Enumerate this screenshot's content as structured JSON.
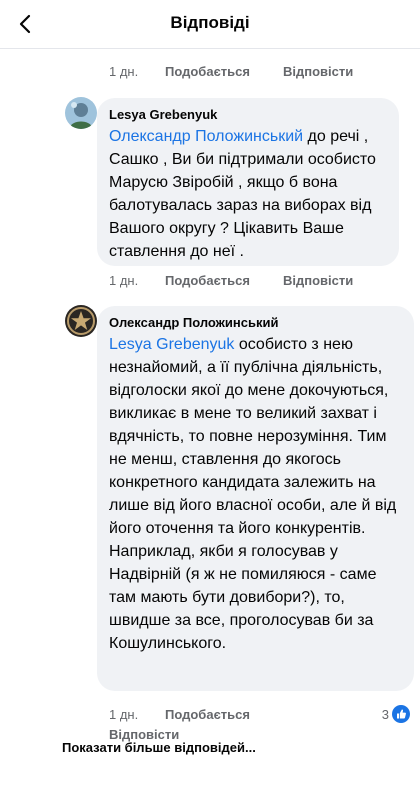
{
  "header": {
    "title": "Відповіді"
  },
  "top_actions": {
    "time": "1 дн.",
    "like": "Подобається",
    "reply": "Відповісти"
  },
  "comments": [
    {
      "author": "Lesya Grebenyuk",
      "mention": "Олександр Положинський",
      "text": " до речі , Сашко , Ви би підтримали особисто Марусю Звіробій , якщо б вона балотувалась зараз на виборах від Вашого округу ? Цікавить Ваше ставлення до неї .",
      "time": "1 дн.",
      "like": "Подобається",
      "reply": "Відповісти"
    },
    {
      "author": "Олександр Положинський",
      "mention": "Lesya Grebenyuk",
      "text": " особисто з нею незнайомий, а її публічна діяльність, відголоски якої до мене докочуються, викликає в мене то великий захват і вдячність, то повне нерозуміння. Тим не менш, ставлення до якогось конкретного кандидата залежить на лише від його власної особи, але й від його оточення та його конкурентів. Наприклад, якби я голосував у Надвірній (я ж не помиляюся - саме там мають бути довибори?), то, швидше за все, проголосував би за Кошулинського.",
      "time": "1 дн.",
      "like": "Подобається",
      "reply": "Відповісти",
      "reaction_count": "3"
    }
  ],
  "more_replies": "Показати більше відповідей...",
  "colors": {
    "link": "#1b74e4",
    "bubble": "#f0f2f5",
    "meta": "#65676b"
  }
}
